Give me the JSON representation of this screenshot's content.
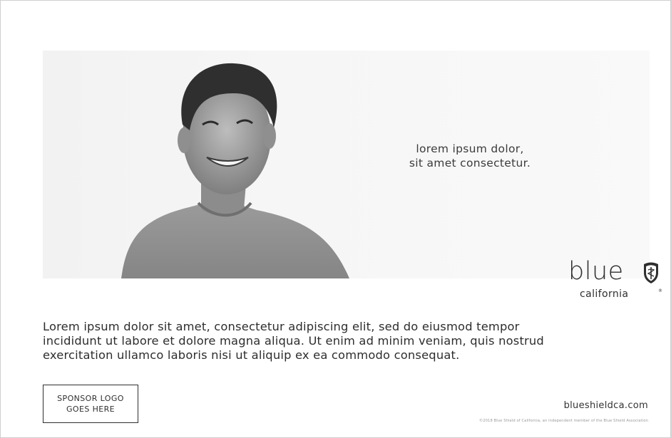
{
  "hero": {
    "headline_line1": "lorem ipsum dolor,",
    "headline_line2": "sit amet consectetur."
  },
  "brand": {
    "word": "blue",
    "sub": "california",
    "registered_mark": "®",
    "logo_icon": "shield-caduceus-icon"
  },
  "body": {
    "line1": "Lorem ipsum dolor sit amet, consectetur adipiscing elit, sed do eiusmod tempor",
    "line2": "incididunt ut labore et dolore magna aliqua. Ut enim ad minim veniam, quis nostrud",
    "line3": "exercitation ullamco laboris nisi ut aliquip ex ea commodo consequat."
  },
  "sponsor": {
    "line1": "SPONSOR LOGO",
    "line2": "GOES HERE"
  },
  "footer": {
    "url": "blueshieldca.com",
    "legal": "©2018 Blue Shield of California, an independent member of the Blue Shield Association"
  }
}
